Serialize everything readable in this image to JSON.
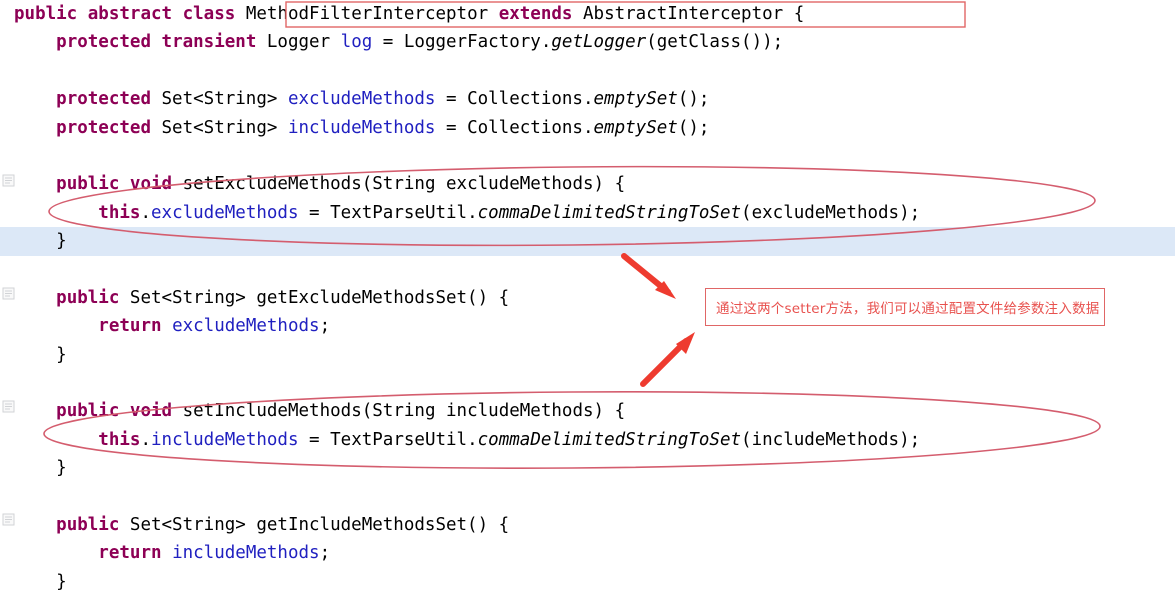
{
  "editor": {
    "language": "java",
    "background_color": "#ffffff",
    "current_line_color": "#dce8f7",
    "keyword_color": "#8d0055",
    "field_color": "#2020c0",
    "plain_color": "#000000",
    "annotation_color": "#e8524f",
    "highlighted_line_index": 7
  },
  "code": {
    "lines": [
      {
        "index": 0,
        "tokens": [
          {
            "t": "public",
            "c": "kw"
          },
          {
            "t": " ",
            "c": "pln"
          },
          {
            "t": "abstract",
            "c": "kw"
          },
          {
            "t": " ",
            "c": "pln"
          },
          {
            "t": "class",
            "c": "kw"
          },
          {
            "t": " MethodFilterInterceptor ",
            "c": "pln"
          },
          {
            "t": "extends",
            "c": "kw"
          },
          {
            "t": " AbstractInterceptor {",
            "c": "pln"
          }
        ]
      },
      {
        "index": 1,
        "tokens": [
          {
            "t": "    ",
            "c": "pln"
          },
          {
            "t": "protected",
            "c": "kw"
          },
          {
            "t": " ",
            "c": "pln"
          },
          {
            "t": "transient",
            "c": "kw"
          },
          {
            "t": " Logger ",
            "c": "pln"
          },
          {
            "t": "log",
            "c": "fld"
          },
          {
            "t": " = LoggerFactory.",
            "c": "pln"
          },
          {
            "t": "getLogger",
            "c": "mth"
          },
          {
            "t": "(getClass());",
            "c": "pln"
          }
        ]
      },
      {
        "index": 2,
        "tokens": []
      },
      {
        "index": 3,
        "tokens": [
          {
            "t": "    ",
            "c": "pln"
          },
          {
            "t": "protected",
            "c": "kw"
          },
          {
            "t": " Set<String> ",
            "c": "pln"
          },
          {
            "t": "excludeMethods",
            "c": "fld"
          },
          {
            "t": " = Collections.",
            "c": "pln"
          },
          {
            "t": "emptySet",
            "c": "mth"
          },
          {
            "t": "();",
            "c": "pln"
          }
        ]
      },
      {
        "index": 4,
        "tokens": [
          {
            "t": "    ",
            "c": "pln"
          },
          {
            "t": "protected",
            "c": "kw"
          },
          {
            "t": " Set<String> ",
            "c": "pln"
          },
          {
            "t": "includeMethods",
            "c": "fld"
          },
          {
            "t": " = Collections.",
            "c": "pln"
          },
          {
            "t": "emptySet",
            "c": "mth"
          },
          {
            "t": "();",
            "c": "pln"
          }
        ]
      },
      {
        "index": 5,
        "tokens": []
      },
      {
        "index": 6,
        "tokens": [
          {
            "t": "    ",
            "c": "pln"
          },
          {
            "t": "public",
            "c": "kw"
          },
          {
            "t": " ",
            "c": "pln"
          },
          {
            "t": "void",
            "c": "kw"
          },
          {
            "t": " setExcludeMethods(String excludeMethods) {",
            "c": "pln"
          }
        ]
      },
      {
        "index": 7,
        "tokens": [
          {
            "t": "        ",
            "c": "pln"
          },
          {
            "t": "this",
            "c": "kw"
          },
          {
            "t": ".",
            "c": "pln"
          },
          {
            "t": "excludeMethods",
            "c": "fld"
          },
          {
            "t": " = TextParseUtil.",
            "c": "pln"
          },
          {
            "t": "commaDelimitedStringToSet",
            "c": "mth"
          },
          {
            "t": "(excludeMethods);",
            "c": "pln"
          }
        ]
      },
      {
        "index": 8,
        "tokens": [
          {
            "t": "    }",
            "c": "pln"
          }
        ]
      },
      {
        "index": 9,
        "tokens": []
      },
      {
        "index": 10,
        "tokens": [
          {
            "t": "    ",
            "c": "pln"
          },
          {
            "t": "public",
            "c": "kw"
          },
          {
            "t": " Set<String> getExcludeMethodsSet() {",
            "c": "pln"
          }
        ]
      },
      {
        "index": 11,
        "tokens": [
          {
            "t": "        ",
            "c": "pln"
          },
          {
            "t": "return",
            "c": "kw"
          },
          {
            "t": " ",
            "c": "pln"
          },
          {
            "t": "excludeMethods",
            "c": "fld"
          },
          {
            "t": ";",
            "c": "pln"
          }
        ]
      },
      {
        "index": 12,
        "tokens": [
          {
            "t": "    }",
            "c": "pln"
          }
        ]
      },
      {
        "index": 13,
        "tokens": []
      },
      {
        "index": 14,
        "tokens": [
          {
            "t": "    ",
            "c": "pln"
          },
          {
            "t": "public",
            "c": "kw"
          },
          {
            "t": " ",
            "c": "pln"
          },
          {
            "t": "void",
            "c": "kw"
          },
          {
            "t": " setIncludeMethods(String includeMethods) {",
            "c": "pln"
          }
        ]
      },
      {
        "index": 15,
        "tokens": [
          {
            "t": "        ",
            "c": "pln"
          },
          {
            "t": "this",
            "c": "kw"
          },
          {
            "t": ".",
            "c": "pln"
          },
          {
            "t": "includeMethods",
            "c": "fld"
          },
          {
            "t": " = TextParseUtil.",
            "c": "pln"
          },
          {
            "t": "commaDelimitedStringToSet",
            "c": "mth"
          },
          {
            "t": "(includeMethods);",
            "c": "pln"
          }
        ]
      },
      {
        "index": 16,
        "tokens": [
          {
            "t": "    }",
            "c": "pln"
          }
        ]
      },
      {
        "index": 17,
        "tokens": []
      },
      {
        "index": 18,
        "tokens": [
          {
            "t": "    ",
            "c": "pln"
          },
          {
            "t": "public",
            "c": "kw"
          },
          {
            "t": " Set<String> getIncludeMethodsSet() {",
            "c": "pln"
          }
        ]
      },
      {
        "index": 19,
        "tokens": [
          {
            "t": "        ",
            "c": "pln"
          },
          {
            "t": "return",
            "c": "kw"
          },
          {
            "t": " ",
            "c": "pln"
          },
          {
            "t": "includeMethods",
            "c": "fld"
          },
          {
            "t": ";",
            "c": "pln"
          }
        ]
      },
      {
        "index": 20,
        "tokens": [
          {
            "t": "    }",
            "c": "pln"
          }
        ]
      }
    ]
  },
  "annotations": {
    "note": {
      "text": "通过这两个setter方法，我们可以通过配置文件给参数注入数据",
      "color": "#e8524f"
    },
    "class_box": {
      "label": "MethodFilterInterceptor extends AbstractInterceptor",
      "color": "#e06666"
    },
    "ellipses": [
      {
        "label": "setExcludeMethods body circled"
      },
      {
        "label": "setIncludeMethods body circled"
      }
    ],
    "arrows": [
      {
        "label": "arrow-to-exclude-setter"
      },
      {
        "label": "arrow-to-include-setter"
      }
    ]
  }
}
